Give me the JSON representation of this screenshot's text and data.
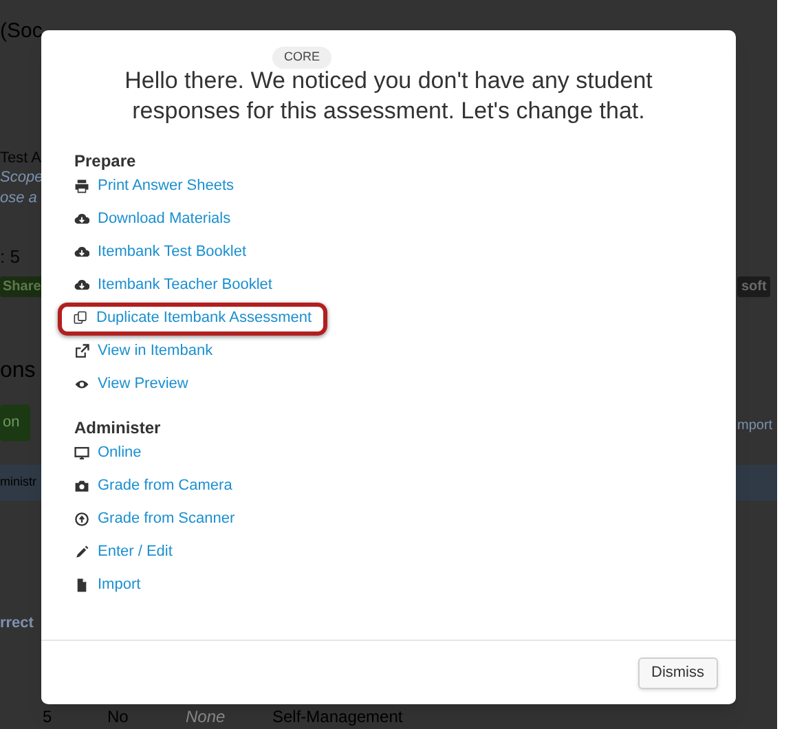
{
  "background_page": {
    "title": "(Soc",
    "lines": [
      "Test A",
      "Scope",
      "ose a",
      ": 5"
    ],
    "share_badge": "Share",
    "soft_badge": "soft",
    "heading": "ons",
    "button": "on",
    "header_bar": "ministr",
    "import_link": "mport",
    "column_header": "rrect",
    "table_row": [
      "5",
      "No",
      "None",
      "Self-Management"
    ]
  },
  "modal": {
    "badge": "CORE",
    "heading": "Hello there. We noticed you don't have any student responses for this assessment. Let's change that.",
    "sections": [
      {
        "title": "Prepare",
        "items": [
          {
            "label": "Print Answer Sheets",
            "highlighted": false
          },
          {
            "label": "Download Materials",
            "highlighted": false
          },
          {
            "label": "Itembank Test Booklet",
            "highlighted": false
          },
          {
            "label": "Itembank Teacher Booklet",
            "highlighted": false
          },
          {
            "label": "Duplicate Itembank Assessment",
            "highlighted": true
          },
          {
            "label": "View in Itembank",
            "highlighted": false
          },
          {
            "label": "View Preview",
            "highlighted": false
          }
        ]
      },
      {
        "title": "Administer",
        "items": [
          {
            "label": "Online",
            "highlighted": false
          },
          {
            "label": "Grade from Camera",
            "highlighted": false
          },
          {
            "label": "Grade from Scanner",
            "highlighted": false
          },
          {
            "label": "Enter / Edit",
            "highlighted": false
          },
          {
            "label": "Import",
            "highlighted": false
          }
        ]
      }
    ],
    "dismiss_button": "Dismiss"
  }
}
